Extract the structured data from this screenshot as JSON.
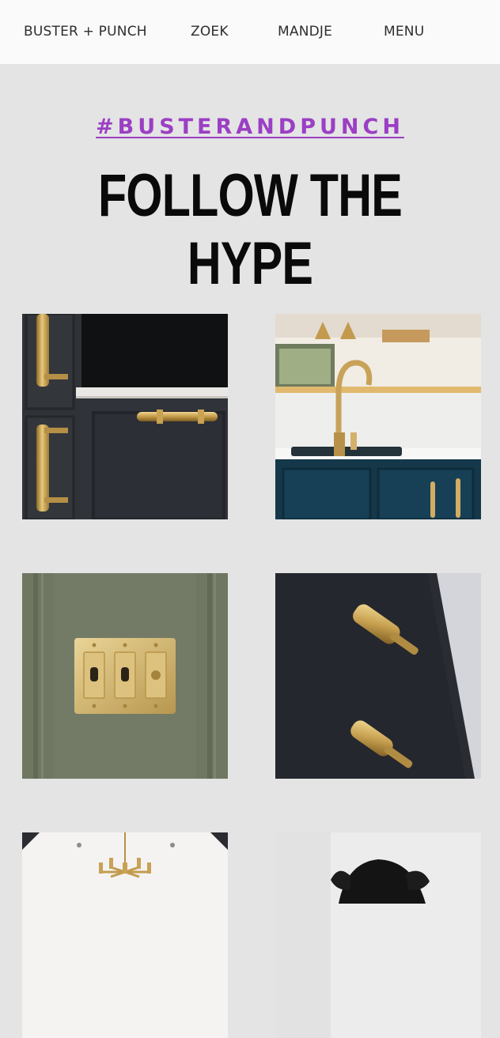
{
  "header": {
    "brand": "BUSTER + PUNCH",
    "search_label": "ZOEK",
    "cart_label": "MANDJE",
    "menu_label": "MENU"
  },
  "feed": {
    "hashtag": "#BUSTERANDPUNCH",
    "title": "FOLLOW THE HYPE",
    "accent_color": "#9b3fc4",
    "posts": [
      {
        "subject": "brass knurled pull handles on dark cabinet"
      },
      {
        "subject": "brass kitchen tap on white marble counter with teal cabinets"
      },
      {
        "subject": "brass toggle switch plate on sage green wall"
      },
      {
        "subject": "brass knurled T-bar knobs on dark drawer"
      },
      {
        "subject": "brass chandelier under white ceiling"
      },
      {
        "subject": "black dog portrait"
      }
    ]
  }
}
